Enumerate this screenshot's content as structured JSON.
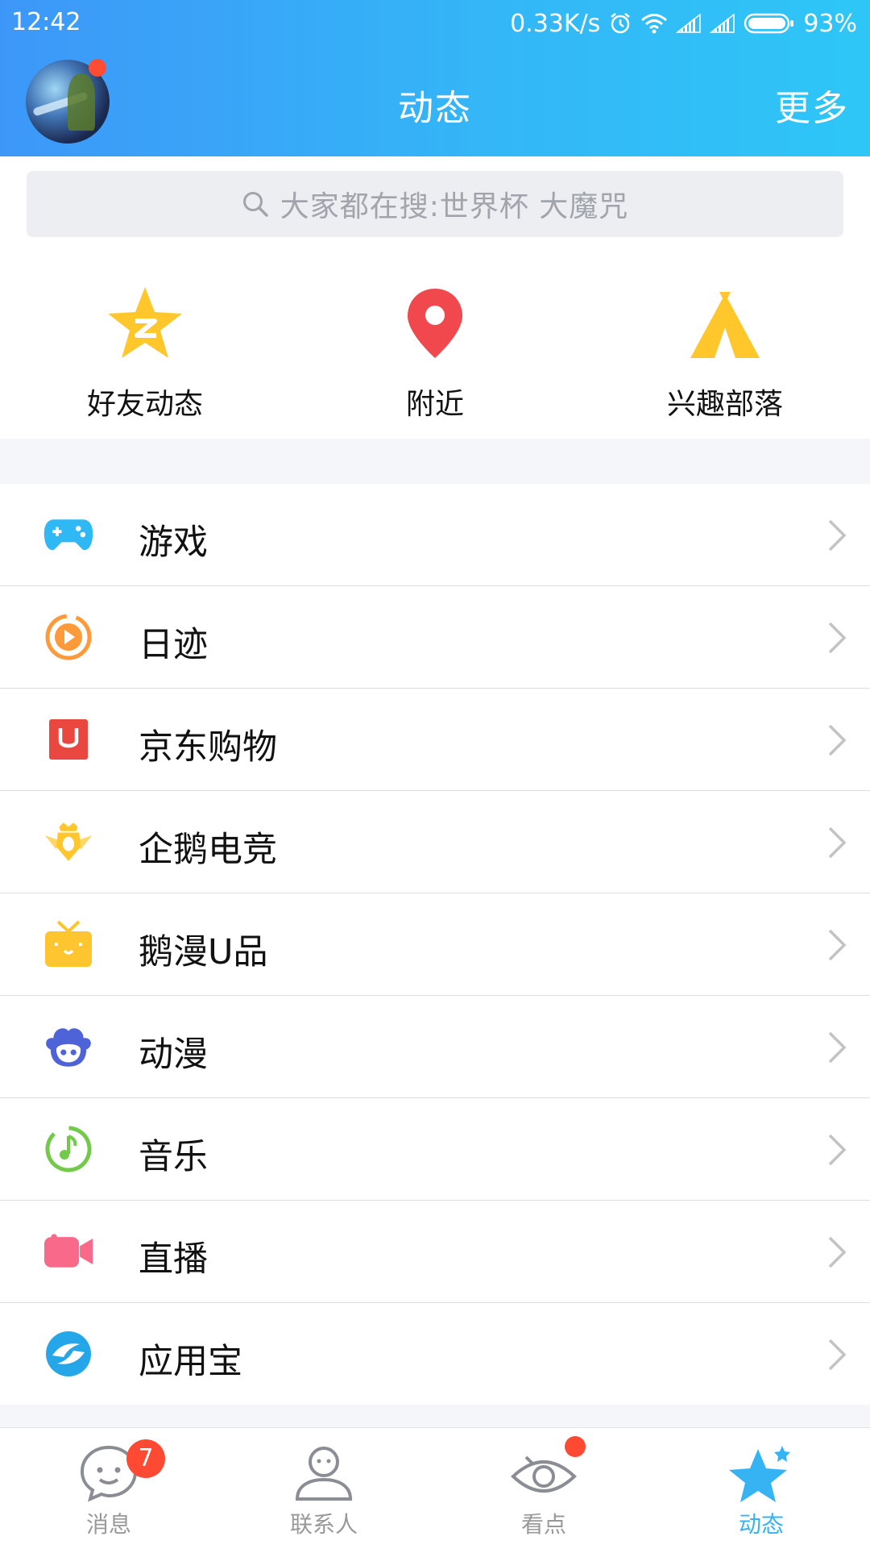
{
  "status_bar": {
    "time": "12:42",
    "net_speed": "0.33K/s",
    "battery": "93%",
    "icons": [
      "alarm-icon",
      "wifi-icon",
      "signal-icon",
      "signal-icon",
      "battery-icon"
    ]
  },
  "header": {
    "title": "动态",
    "more": "更多",
    "avatar_has_dot": true
  },
  "search": {
    "placeholder": "大家都在搜:世界杯 大魔咒",
    "icon": "search-icon"
  },
  "shortcuts": [
    {
      "label": "好友动态",
      "icon": "qzone-star-icon",
      "color": "#ffc72c"
    },
    {
      "label": "附近",
      "icon": "location-pin-icon",
      "color": "#f0484d"
    },
    {
      "label": "兴趣部落",
      "icon": "tent-icon",
      "color": "#ffc72c"
    }
  ],
  "list": [
    {
      "label": "游戏",
      "icon": "gamepad-icon",
      "color": "#2fb8f3"
    },
    {
      "label": "日迹",
      "icon": "play-circle-icon",
      "color": "#ff9a3b"
    },
    {
      "label": "京东购物",
      "icon": "jd-bag-icon",
      "color": "#e9473f"
    },
    {
      "label": "企鹅电竞",
      "icon": "esports-crown-icon",
      "color": "#ffc72c"
    },
    {
      "label": "鹅漫U品",
      "icon": "gift-box-icon",
      "color": "#ffc530"
    },
    {
      "label": "动漫",
      "icon": "anime-face-icon",
      "color": "#4f63d8"
    },
    {
      "label": "音乐",
      "icon": "music-note-icon",
      "color": "#72c94a"
    },
    {
      "label": "直播",
      "icon": "video-camera-icon",
      "color": "#f96a8a"
    },
    {
      "label": "应用宝",
      "icon": "app-store-icon",
      "color": "#25a6e8"
    }
  ],
  "bottom_nav": [
    {
      "label": "消息",
      "icon": "chat-bubble-icon",
      "badge": "7",
      "active": false
    },
    {
      "label": "联系人",
      "icon": "contacts-icon",
      "active": false
    },
    {
      "label": "看点",
      "icon": "eye-icon",
      "dot": true,
      "active": false
    },
    {
      "label": "动态",
      "icon": "star-icon",
      "active": true
    }
  ],
  "colors": {
    "header_gradient_start": "#3d97f8",
    "header_gradient_end": "#2ec6f7",
    "active_tab": "#36b3f3",
    "badge": "#ff4a33"
  }
}
